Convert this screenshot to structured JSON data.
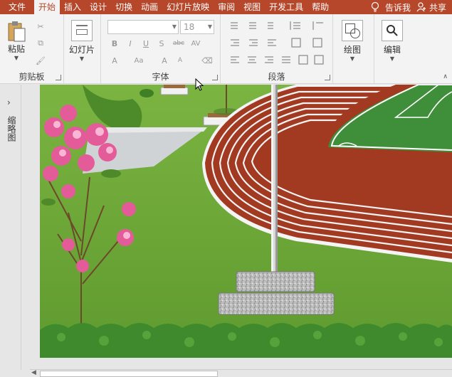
{
  "tabs": [
    {
      "label": "文件"
    },
    {
      "label": "开始"
    },
    {
      "label": "插入"
    },
    {
      "label": "设计"
    },
    {
      "label": "切换"
    },
    {
      "label": "动画"
    },
    {
      "label": "幻灯片放映"
    },
    {
      "label": "审阅"
    },
    {
      "label": "视图"
    },
    {
      "label": "开发工具"
    },
    {
      "label": "帮助"
    }
  ],
  "active_tab": "开始",
  "tell_me": "告诉我",
  "share": "共享",
  "ribbon": {
    "clipboard": {
      "label": "剪贴板",
      "paste": "粘贴"
    },
    "slides": {
      "new_slide": "幻灯片"
    },
    "font": {
      "label": "字体",
      "font_name": "",
      "font_size": "18"
    },
    "paragraph": {
      "label": "段落"
    },
    "drawing": {
      "label": "绘图"
    },
    "editing": {
      "label": "编辑"
    }
  },
  "left_pane": {
    "label": "缩略图"
  },
  "colors": {
    "accent": "#b7472a",
    "track": "#a23a22",
    "field": "#3f8f3a",
    "grass": "#6ea63a"
  }
}
